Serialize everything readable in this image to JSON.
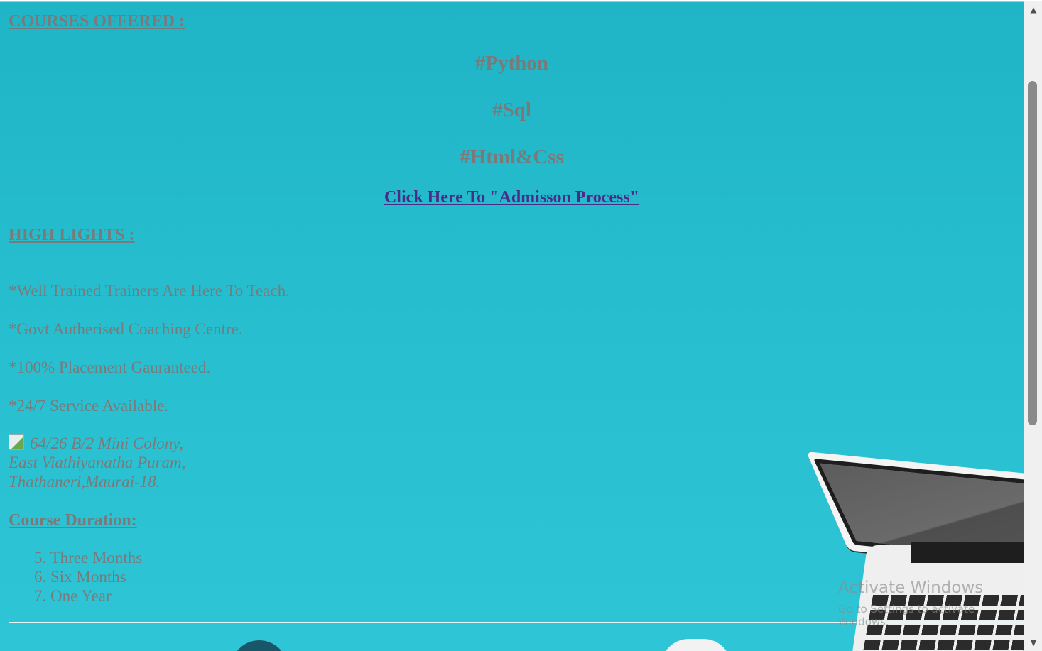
{
  "courses": {
    "title": "COURSES OFFERED :",
    "items": [
      "#Python",
      "#Sql",
      "#Html&Css"
    ],
    "admission_link": "Click Here To \"Admisson Process\""
  },
  "highlights": {
    "title": "HIGH LIGHTS :",
    "items": [
      "*Well Trained Trainers Are Here To Teach.",
      "*Govt Autherised Coaching Centre.",
      "*100% Placement Gauranteed.",
      "*24/7 Service Available."
    ]
  },
  "address": {
    "line1": "64/26 B/2 Mini Colony,",
    "line2": "East Viathiyanatha Puram,",
    "line3": "Thathaneri,Maurai-18."
  },
  "duration": {
    "title": "Course Duration:",
    "items": [
      "5. Three Months",
      "6. Six Months",
      "7. One Year"
    ]
  },
  "watermark": {
    "title": "Activate Windows",
    "subtitle": "Go to Settings to activate Windows."
  },
  "scrollbar": {
    "up_icon": "▲",
    "down_icon": "▼"
  },
  "colors": {
    "background": "#25bccc",
    "text": "#7a7a7a",
    "link": "#4b2a8a"
  }
}
